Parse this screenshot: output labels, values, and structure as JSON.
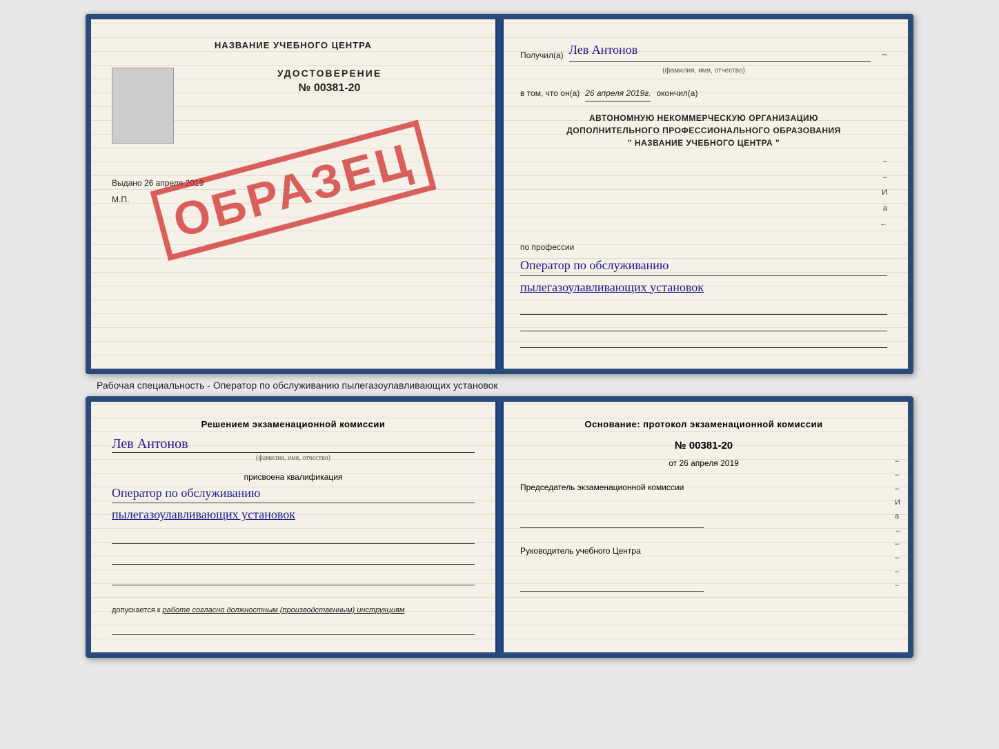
{
  "top_book": {
    "left": {
      "header": "НАЗВАНИЕ УЧЕБНОГО ЦЕНТРА",
      "cert_title": "УДОСТОВЕРЕНИЕ",
      "cert_number": "№ 00381-20",
      "issued_label": "Выдано",
      "issued_date": "26 апреля 2019",
      "mp_label": "М.П.",
      "stamp_text": "ОБРАЗЕЦ"
    },
    "right": {
      "received_label": "Получил(а)",
      "recipient_name": "Лев Антонов",
      "fio_sub": "(фамилия, имя, отчество)",
      "date_prefix": "в том, что он(а)",
      "date_value": "26 апреля 2019г.",
      "finished_label": "окончил(а)",
      "org_line1": "АВТОНОМНУЮ НЕКОММЕРЧЕСКУЮ ОРГАНИЗАЦИЮ",
      "org_line2": "ДОПОЛНИТЕЛЬНОГО ПРОФЕССИОНАЛЬНОГО ОБРАЗОВАНИЯ",
      "org_line3": "\"  НАЗВАНИЕ УЧЕБНОГО ЦЕНТРА  \"",
      "profession_label": "по профессии",
      "profession_line1": "Оператор по обслуживанию",
      "profession_line2": "пылегазоулавливающих установок"
    }
  },
  "specialty_text": "Рабочая специальность - Оператор по обслуживанию пылегазоулавливающих установок",
  "bottom_book": {
    "left": {
      "commission_prefix": "Решением экзаменационной комиссии",
      "person_name": "Лев Антонов",
      "fio_sub": "(фамилия, имя, отчество)",
      "qualification_label": "присвоена квалификация",
      "qualification_line1": "Оператор по обслуживанию",
      "qualification_line2": "пылегазоулавливающих установок",
      "allowed_label": "допускается к",
      "allowed_value": "работе согласно должностным (производственным) инструкциям"
    },
    "right": {
      "basis_label": "Основание: протокол экзаменационной комиссии",
      "protocol_number": "№ 00381-20",
      "protocol_date_prefix": "от",
      "protocol_date": "26 апреля 2019",
      "chairman_label": "Председатель экзаменационной комиссии",
      "director_label": "Руководитель учебного Центра"
    },
    "side_marks": [
      "–",
      "–",
      "–",
      "И",
      "а",
      "←",
      "–",
      "–",
      "–",
      "–"
    ]
  }
}
